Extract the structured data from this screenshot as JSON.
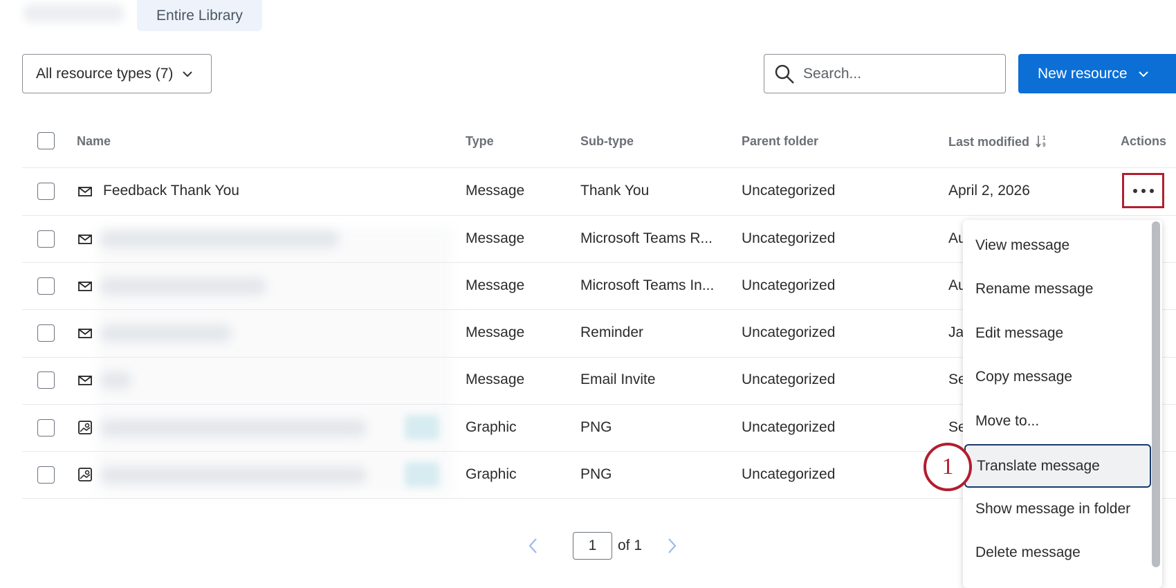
{
  "tabs": {
    "entire_library": "Entire Library"
  },
  "toolbar": {
    "filter_label": "All resource types (7)",
    "search_placeholder": "Search...",
    "new_resource_label": "New resource"
  },
  "table": {
    "columns": {
      "name": "Name",
      "type": "Type",
      "subtype": "Sub-type",
      "parent_folder": "Parent folder",
      "last_modified": "Last modified",
      "actions": "Actions"
    },
    "rows": [
      {
        "icon": "envelope-icon",
        "name": "Feedback Thank You",
        "type": "Message",
        "subtype": "Thank You",
        "folder": "Uncategorized",
        "modified": "April 2, 2026"
      },
      {
        "icon": "envelope-icon",
        "name": "",
        "type": "Message",
        "subtype": "Microsoft Teams R...",
        "folder": "Uncategorized",
        "modified": "Au"
      },
      {
        "icon": "envelope-icon",
        "name": "",
        "type": "Message",
        "subtype": "Microsoft Teams In...",
        "folder": "Uncategorized",
        "modified": "Au"
      },
      {
        "icon": "envelope-icon",
        "name": "",
        "type": "Message",
        "subtype": "Reminder",
        "folder": "Uncategorized",
        "modified": "Ja"
      },
      {
        "icon": "envelope-icon",
        "name": "",
        "type": "Message",
        "subtype": "Email Invite",
        "folder": "Uncategorized",
        "modified": "Se"
      },
      {
        "icon": "image-icon",
        "name": "",
        "type": "Graphic",
        "subtype": "PNG",
        "folder": "Uncategorized",
        "modified": "Se"
      },
      {
        "icon": "image-icon",
        "name": "",
        "type": "Graphic",
        "subtype": "PNG",
        "folder": "Uncategorized",
        "modified": ""
      }
    ]
  },
  "context_menu": {
    "items": [
      "View message",
      "Rename message",
      "Edit message",
      "Copy message",
      "Move to...",
      "Translate message",
      "Show message in folder",
      "Delete message"
    ]
  },
  "annotation": {
    "step": "1"
  },
  "pagination": {
    "current": "1",
    "total_label": "of 1"
  },
  "colors": {
    "primary": "#0b6fd6",
    "annotation": "#b11e2f",
    "focus": "#17386b"
  }
}
